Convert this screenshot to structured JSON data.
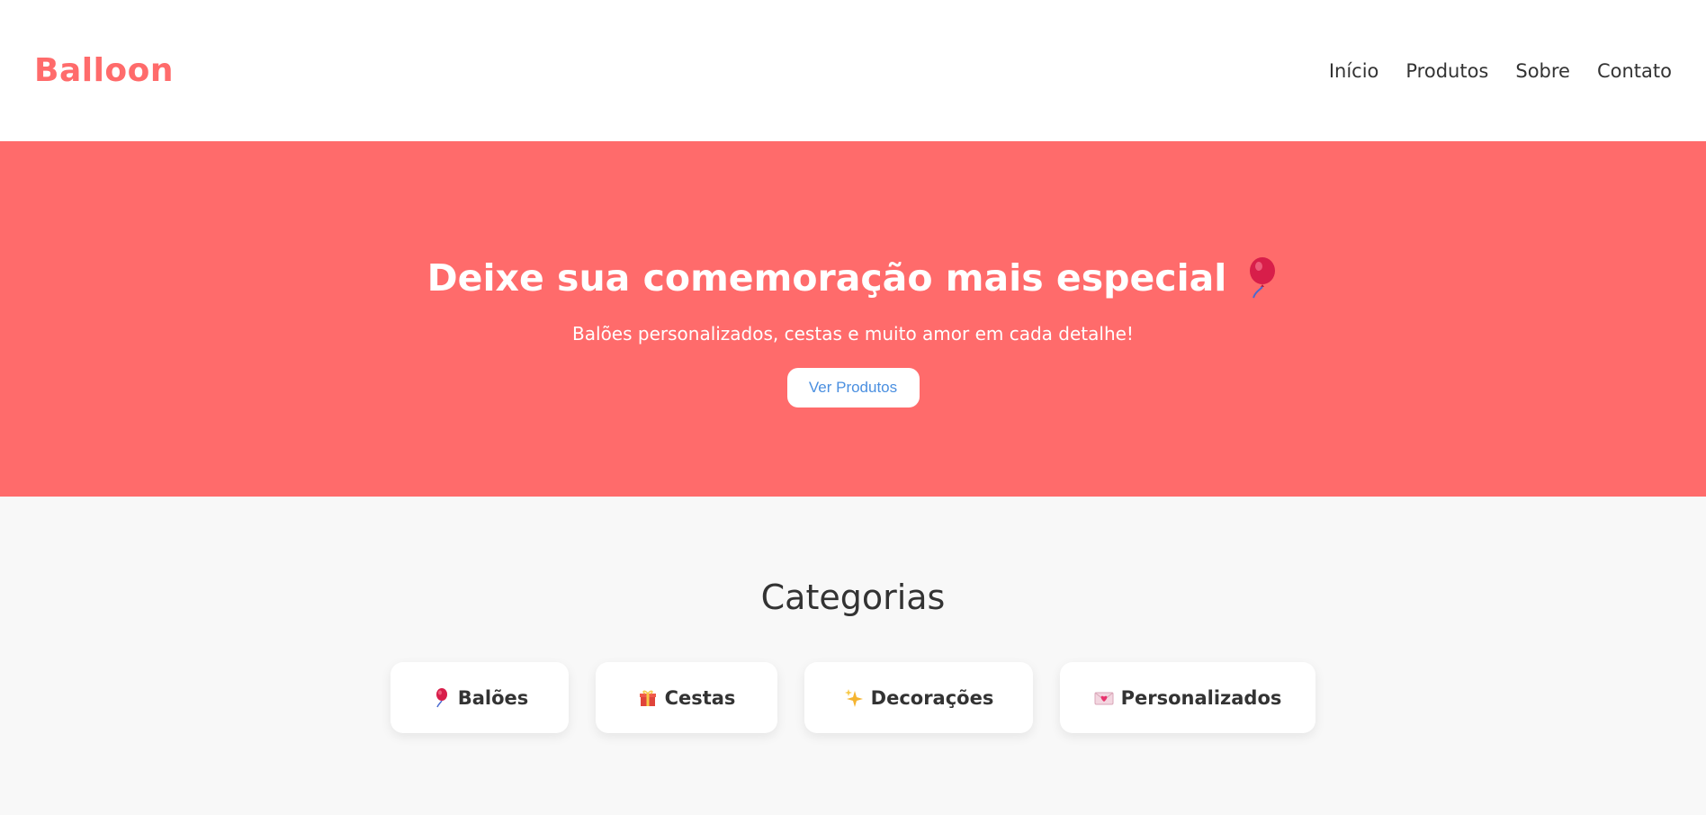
{
  "header": {
    "logo": "Balloon",
    "nav": [
      {
        "label": "Início"
      },
      {
        "label": "Produtos"
      },
      {
        "label": "Sobre"
      },
      {
        "label": "Contato"
      }
    ]
  },
  "hero": {
    "title": "Deixe sua comemoração mais especial",
    "title_icon": "balloon-icon",
    "subtitle": "Balões personalizados, cestas e muito amor em cada detalhe!",
    "button_label": "Ver Produtos"
  },
  "categories": {
    "title": "Categorias",
    "items": [
      {
        "label": "Balões",
        "icon": "balloon-icon"
      },
      {
        "label": "Cestas",
        "icon": "gift-icon"
      },
      {
        "label": "Decorações",
        "icon": "sparkles-icon"
      },
      {
        "label": "Personalizados",
        "icon": "love-letter-icon"
      }
    ]
  },
  "colors": {
    "brand": "#ff6b6b",
    "button_text": "#4a8fe0",
    "text": "#333333",
    "background": "#f8f8f8"
  }
}
